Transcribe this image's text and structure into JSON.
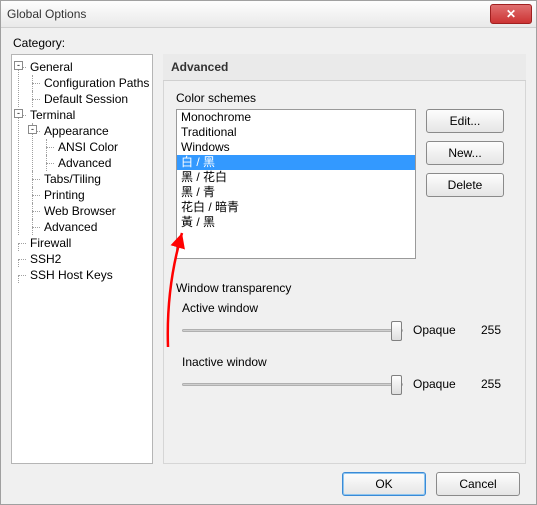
{
  "window": {
    "title": "Global Options",
    "close_glyph": "✕"
  },
  "category_label": "Category:",
  "tree": {
    "general": {
      "toggle": "-",
      "label": "General"
    },
    "config_paths": "Configuration Paths",
    "default_session": "Default Session",
    "terminal": {
      "toggle": "-",
      "label": "Terminal"
    },
    "appearance": {
      "toggle": "-",
      "label": "Appearance"
    },
    "ansi_color": "ANSI Color",
    "advanced_app": "Advanced",
    "tabs_tiling": "Tabs/Tiling",
    "printing": "Printing",
    "web_browser": "Web Browser",
    "advanced_term": "Advanced",
    "firewall": "Firewall",
    "ssh2": "SSH2",
    "ssh_host_keys": "SSH Host Keys"
  },
  "panel": {
    "title": "Advanced",
    "color_schemes_label": "Color schemes",
    "schemes": [
      "Monochrome",
      "Traditional",
      "Windows",
      "白 / 黑",
      "黑 / 花白",
      "黑 / 青",
      "花白 / 暗青",
      "黃 / 黑"
    ],
    "selected_index": 3,
    "buttons": {
      "edit": "Edit...",
      "new": "New...",
      "delete": "Delete"
    },
    "transparency": {
      "group": "Window transparency",
      "active_label": "Active window",
      "inactive_label": "Inactive window",
      "opaque": "Opaque",
      "active_value": "255",
      "inactive_value": "255"
    }
  },
  "footer": {
    "ok": "OK",
    "cancel": "Cancel"
  }
}
